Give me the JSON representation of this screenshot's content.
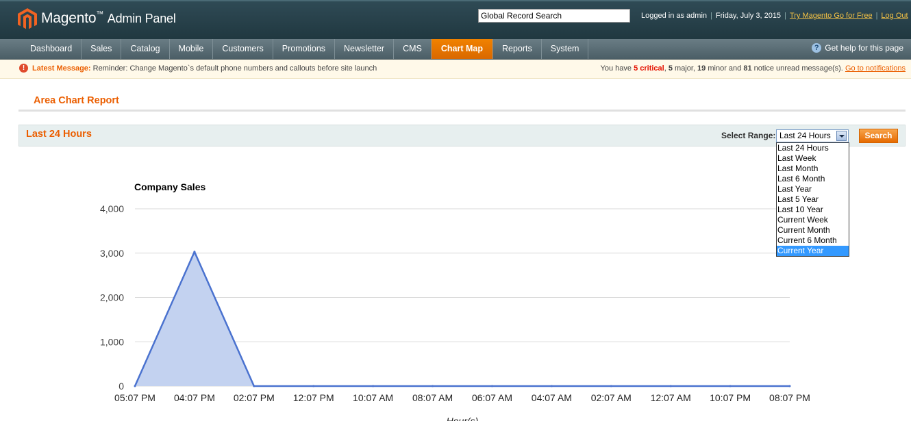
{
  "app": {
    "logo_main": "Magento",
    "logo_sub": "Admin Panel",
    "global_search_value": "Global Record Search",
    "logged_in": "Logged in as admin",
    "date": "Friday, July 3, 2015",
    "try_link": "Try Magento Go for Free",
    "logout": "Log Out"
  },
  "nav": {
    "items": [
      "Dashboard",
      "Sales",
      "Catalog",
      "Mobile",
      "Customers",
      "Promotions",
      "Newsletter",
      "CMS",
      "Chart Map",
      "Reports",
      "System"
    ],
    "active": "Chart Map",
    "help": "Get help for this page"
  },
  "message": {
    "label": "Latest Message:",
    "text": "Reminder: Change Magento`s default phone numbers and callouts before site launch",
    "right_prefix": "You have ",
    "critical": "5 critical",
    "major_count": "5",
    "major_text": " major, ",
    "minor_count": "19",
    "minor_text": " minor and ",
    "notice_count": "81",
    "notice_text": " notice unread message(s). ",
    "link": "Go to notifications"
  },
  "page": {
    "title": "Area Chart Report",
    "box_title": "Last 24 Hours",
    "range_label": "Select Range:",
    "range_value": "Last 24 Hours",
    "search_button": "Search",
    "range_options": [
      "Last 24 Hours",
      "Last Week",
      "Last Month",
      "Last 6 Month",
      "Last Year",
      "Last 5 Year",
      "Last 10 Year",
      "Current Week",
      "Current Month",
      "Current 6 Month",
      "Current Year"
    ],
    "highlighted_option": "Current Year"
  },
  "chart_data": {
    "type": "area",
    "title": "Company Sales",
    "xlabel": "Hour(s)",
    "ylabel": "",
    "categories": [
      "05:07 PM",
      "04:07 PM",
      "02:07 PM",
      "12:07 PM",
      "10:07 AM",
      "08:07 AM",
      "06:07 AM",
      "04:07 AM",
      "02:07 AM",
      "12:07 AM",
      "10:07 PM",
      "08:07 PM"
    ],
    "values": [
      0,
      3030,
      0,
      0,
      0,
      0,
      0,
      0,
      0,
      0,
      0,
      0
    ],
    "y_ticks": [
      "0",
      "1,000",
      "2,000",
      "3,000",
      "4,000"
    ],
    "ylim": [
      0,
      4000
    ],
    "grid": true,
    "colors": {
      "fill": "#c3d2f0",
      "line": "#4a72cf"
    }
  }
}
